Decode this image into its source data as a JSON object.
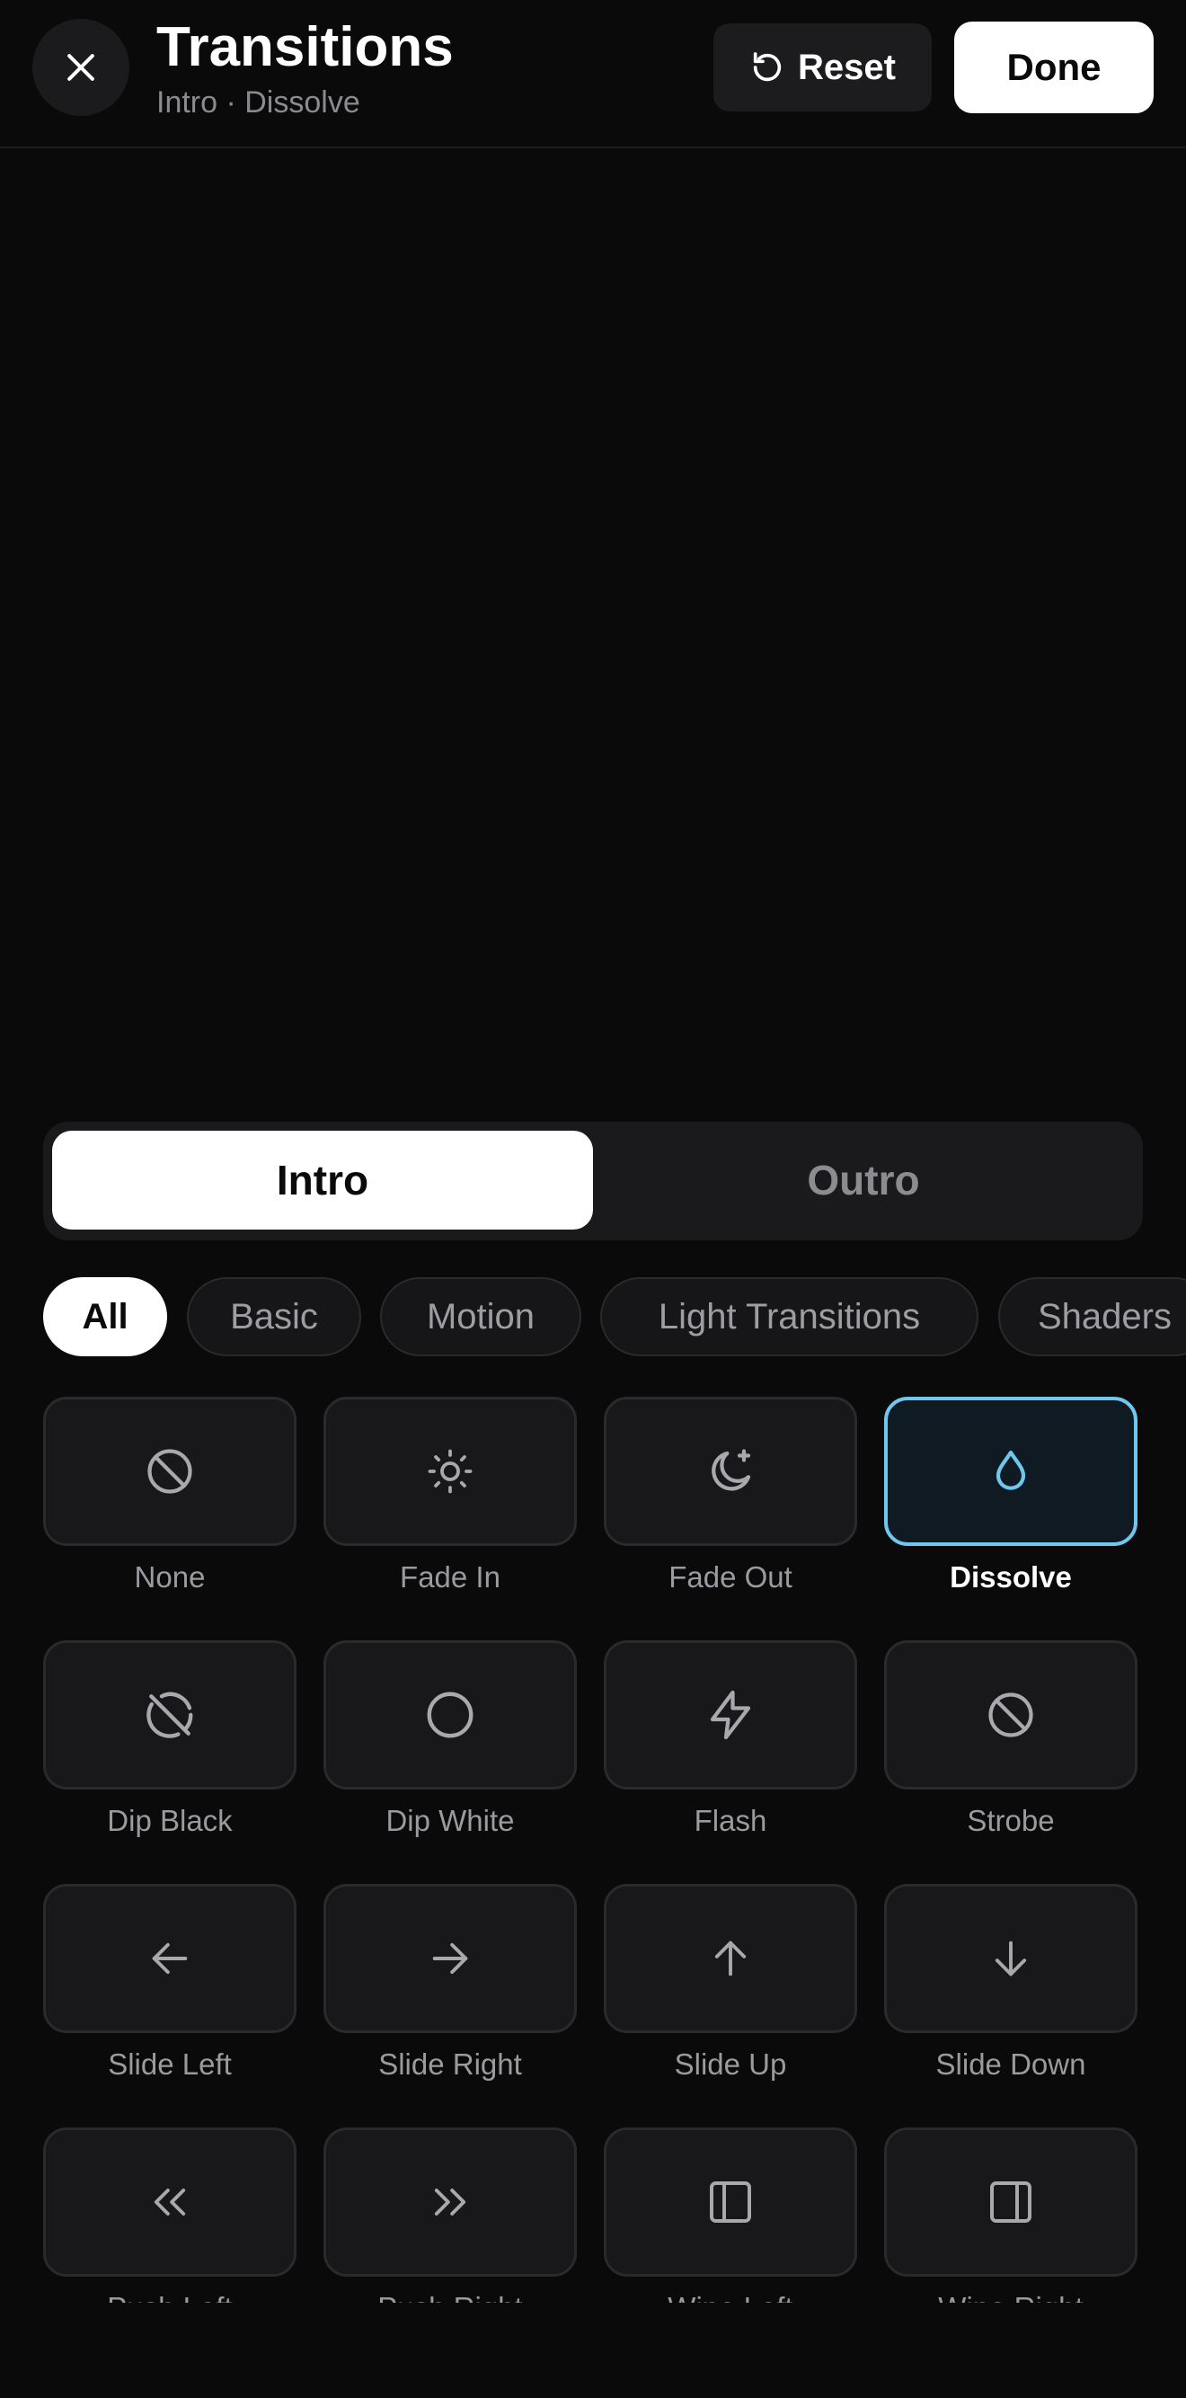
{
  "header": {
    "close_icon": "close-icon",
    "title": "Transitions",
    "subtitle": "Intro · Dissolve",
    "reset_label": "Reset",
    "reset_icon": "reset-icon",
    "done_label": "Done"
  },
  "segment": {
    "tabs": [
      {
        "label": "Intro",
        "active": true
      },
      {
        "label": "Outro",
        "active": false
      }
    ]
  },
  "categories": [
    {
      "label": "All",
      "active": true
    },
    {
      "label": "Basic",
      "active": false
    },
    {
      "label": "Motion",
      "active": false
    },
    {
      "label": "Light Transitions",
      "active": false
    },
    {
      "label": "Shaders",
      "active": false
    }
  ],
  "transitions": [
    {
      "label": "None",
      "icon": "none-icon"
    },
    {
      "label": "Fade In",
      "icon": "sun-icon"
    },
    {
      "label": "Fade Out",
      "icon": "moon-icon"
    },
    {
      "label": "Dissolve",
      "icon": "droplet-icon",
      "selected": true
    },
    {
      "label": "Dip Black",
      "icon": "eye-off-circle-icon"
    },
    {
      "label": "Dip White",
      "icon": "circle-icon"
    },
    {
      "label": "Flash",
      "icon": "lightning-icon"
    },
    {
      "label": "Strobe",
      "icon": "ban-icon"
    },
    {
      "label": "Slide Left",
      "icon": "arrow-left-icon"
    },
    {
      "label": "Slide Right",
      "icon": "arrow-right-icon"
    },
    {
      "label": "Slide Up",
      "icon": "arrow-up-icon"
    },
    {
      "label": "Slide Down",
      "icon": "arrow-down-icon"
    },
    {
      "label": "Push Left",
      "icon": "chevrons-left-icon"
    },
    {
      "label": "Push Right",
      "icon": "chevrons-right-icon"
    },
    {
      "label": "Wipe Left",
      "icon": "panel-left-icon"
    },
    {
      "label": "Wipe Right",
      "icon": "panel-right-icon"
    }
  ],
  "colors": {
    "background": "#0a0a0b",
    "tile": "#18181a",
    "tile_border": "#2a2a2d",
    "accent": "#6fc6ee",
    "text_muted": "#9a9a9f"
  }
}
